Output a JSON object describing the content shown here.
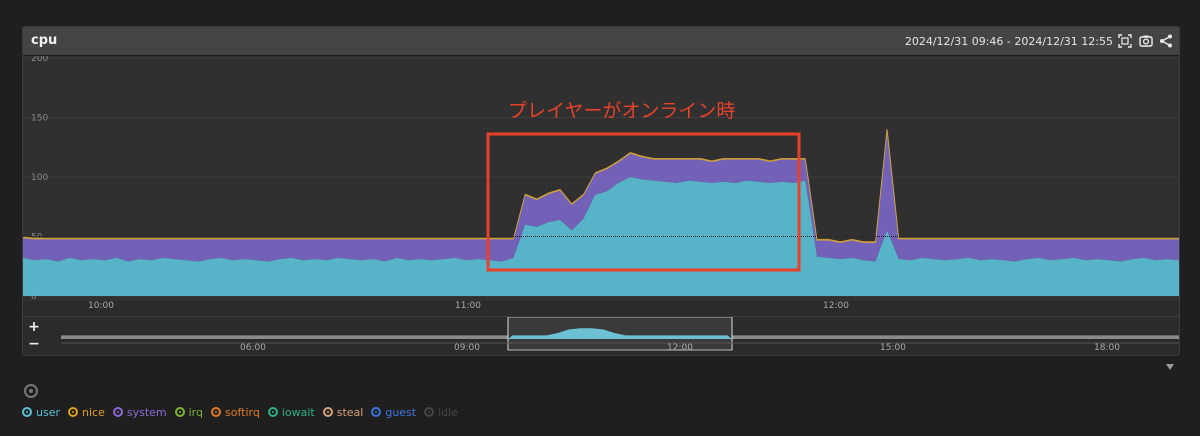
{
  "panel": {
    "title": "cpu",
    "time_range": "2024/12/31 09:46 - 2024/12/31 12:55",
    "icons": [
      "fullscreen-icon",
      "camera-icon",
      "share-icon"
    ]
  },
  "annotation": {
    "text": "プレイヤーがオンライン時",
    "color": "#e8412a"
  },
  "navigator": {
    "zoom_in": "+",
    "zoom_out": "−",
    "labels": [
      "06:00",
      "09:00",
      "12:00",
      "15:00",
      "18:00"
    ]
  },
  "legend": [
    {
      "name": "user",
      "color": "#5bc0d6",
      "enabled": true
    },
    {
      "name": "nice",
      "color": "#e0a020",
      "enabled": true
    },
    {
      "name": "system",
      "color": "#8a6cd6",
      "enabled": true
    },
    {
      "name": "irq",
      "color": "#7db336",
      "enabled": true
    },
    {
      "name": "softirq",
      "color": "#e07a2a",
      "enabled": true
    },
    {
      "name": "iowait",
      "color": "#2fb085",
      "enabled": true
    },
    {
      "name": "steal",
      "color": "#d8a27a",
      "enabled": true
    },
    {
      "name": "guest",
      "color": "#3f74e0",
      "enabled": true
    },
    {
      "name": "idle",
      "color": "#555555",
      "enabled": false
    }
  ],
  "chart_data": {
    "type": "area",
    "stacked": true,
    "x_labels": [
      "10:00",
      "11:00",
      "12:00"
    ],
    "yticks": [
      0,
      50,
      100,
      150,
      200
    ],
    "ylim": [
      0,
      200
    ],
    "reference_line": 50,
    "x": [
      0,
      1,
      2,
      3,
      4,
      5,
      6,
      7,
      8,
      9,
      10,
      11,
      12,
      13,
      14,
      15,
      16,
      17,
      18,
      19,
      20,
      21,
      22,
      23,
      24,
      25,
      26,
      27,
      28,
      29,
      30,
      31,
      32,
      33,
      34,
      35,
      36,
      37,
      38,
      39,
      40,
      41,
      42,
      43,
      44,
      45,
      46,
      47,
      48,
      49,
      50,
      51,
      52,
      53,
      54,
      55,
      56,
      57,
      58,
      59,
      60,
      61,
      62,
      63,
      64,
      65,
      66,
      67,
      68,
      69,
      70,
      71,
      72,
      73,
      74,
      75,
      76,
      77,
      78,
      79,
      80,
      81,
      82,
      83,
      84,
      85,
      86,
      87,
      88,
      89,
      90,
      91,
      92,
      93,
      94,
      95,
      96,
      97,
      98,
      99
    ],
    "series": [
      {
        "name": "user",
        "values": [
          32,
          30,
          31,
          29,
          32,
          30,
          31,
          30,
          32,
          29,
          31,
          30,
          32,
          31,
          30,
          29,
          31,
          32,
          30,
          31,
          30,
          29,
          31,
          32,
          30,
          31,
          30,
          32,
          31,
          30,
          31,
          29,
          32,
          30,
          31,
          30,
          31,
          32,
          30,
          31,
          30,
          29,
          32,
          60,
          58,
          62,
          64,
          55,
          65,
          85,
          88,
          95,
          100,
          98,
          97,
          96,
          95,
          97,
          96,
          95,
          96,
          95,
          97,
          96,
          95,
          96,
          95,
          97,
          33,
          32,
          31,
          32,
          30,
          29,
          55,
          31,
          30,
          32,
          31,
          30,
          31,
          32,
          30,
          31,
          30,
          29,
          31,
          32,
          30,
          31,
          32,
          30,
          31,
          30,
          29,
          31,
          32,
          30,
          31,
          30
        ]
      },
      {
        "name": "system",
        "values": [
          17,
          18,
          17,
          19,
          16,
          18,
          17,
          18,
          16,
          19,
          17,
          18,
          16,
          17,
          18,
          19,
          17,
          16,
          18,
          17,
          18,
          19,
          17,
          16,
          18,
          17,
          18,
          16,
          17,
          18,
          17,
          19,
          16,
          18,
          17,
          18,
          17,
          16,
          18,
          17,
          18,
          19,
          16,
          25,
          23,
          24,
          25,
          22,
          20,
          18,
          19,
          18,
          20,
          19,
          18,
          19,
          20,
          18,
          19,
          18,
          19,
          20,
          18,
          19,
          18,
          19,
          20,
          18,
          14,
          15,
          14,
          15,
          15,
          16,
          85,
          17,
          18,
          16,
          17,
          18,
          17,
          16,
          18,
          17,
          18,
          19,
          17,
          16,
          18,
          17,
          16,
          18,
          17,
          18,
          19,
          17,
          16,
          18,
          17,
          18
        ]
      },
      {
        "name": "nice",
        "values": [
          1,
          1,
          1,
          1,
          1,
          1,
          1,
          1,
          1,
          1,
          1,
          1,
          1,
          1,
          1,
          1,
          1,
          1,
          1,
          1,
          1,
          1,
          1,
          1,
          1,
          1,
          1,
          1,
          1,
          1,
          1,
          1,
          1,
          1,
          1,
          1,
          1,
          1,
          1,
          1,
          1,
          1,
          1,
          1,
          1,
          1,
          1,
          1,
          1,
          1,
          1,
          1,
          1,
          1,
          1,
          1,
          1,
          1,
          1,
          1,
          1,
          1,
          1,
          1,
          1,
          1,
          1,
          1,
          1,
          1,
          1,
          1,
          1,
          1,
          1,
          1,
          1,
          1,
          1,
          1,
          1,
          1,
          1,
          1,
          1,
          1,
          1,
          1,
          1,
          1,
          1,
          1,
          1,
          1,
          1,
          1,
          1,
          1,
          1,
          1
        ]
      }
    ],
    "navigator_series": [
      3,
      3,
      3,
      3,
      3,
      3,
      3,
      3,
      3,
      3,
      3,
      3,
      3,
      3,
      3,
      3,
      3,
      3,
      3,
      3,
      3,
      3,
      3,
      3,
      3,
      3,
      3,
      3,
      3,
      3,
      3,
      3,
      3,
      3,
      3,
      3,
      3,
      3,
      3,
      3,
      3,
      3,
      3,
      3,
      5,
      8,
      9,
      9,
      8,
      5,
      3,
      3,
      3,
      3,
      3,
      3,
      3,
      3,
      3,
      3,
      3,
      3,
      3,
      3,
      3,
      3,
      3,
      3,
      3,
      3,
      3,
      3,
      3,
      3,
      3,
      3,
      3,
      3,
      3,
      3,
      3,
      3,
      3,
      3,
      3,
      3,
      3,
      3,
      3,
      3,
      3,
      3,
      3,
      3,
      3,
      3,
      3,
      3,
      3,
      3
    ],
    "navigator_window": [
      "09:46",
      "12:55"
    ]
  }
}
